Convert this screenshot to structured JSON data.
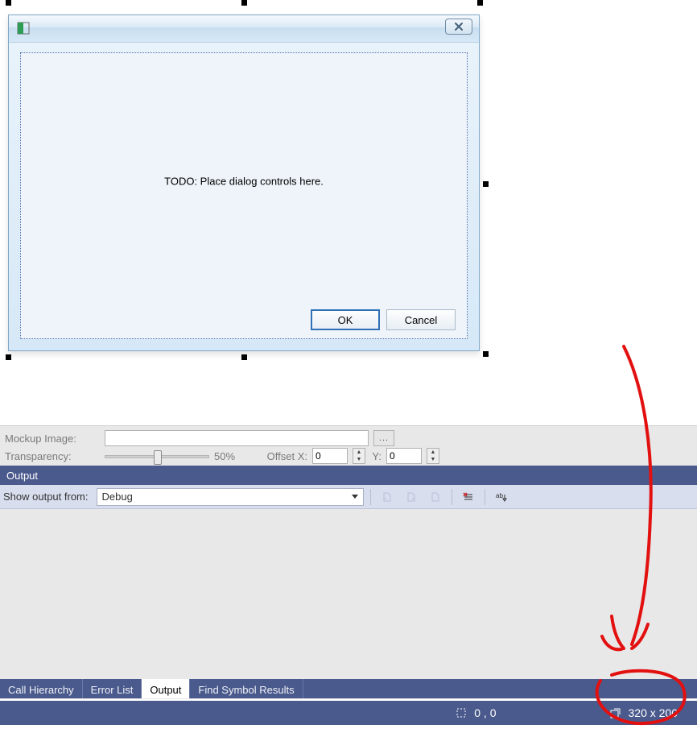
{
  "designer": {
    "dialog": {
      "placeholder": "TODO: Place dialog controls here.",
      "ok_label": "OK",
      "cancel_label": "Cancel",
      "close_icon": "close-icon",
      "sys_icon": "app-icon"
    },
    "selection_size_handles": true
  },
  "mockup_strip": {
    "label": "Mockup Image:",
    "browse_glyph": "...",
    "transparency_label": "Transparency:",
    "transparency_pct": "50%",
    "offset_x_label": "Offset X:",
    "offset_x_value": "0",
    "y_label": "Y:",
    "y_value": "0",
    "slider_pos_pct": 50
  },
  "output_panel": {
    "title": "Output",
    "show_from_label": "Show output from:",
    "selected_source": "Debug",
    "buttons": {
      "prev": "previous-message-icon",
      "next": "next-message-icon",
      "prev2": "previous-message-icon-2",
      "clear": "clear-all-icon",
      "wrap": "toggle-word-wrap-icon"
    }
  },
  "tabs": {
    "items": [
      {
        "label": "Call Hierarchy",
        "active": false
      },
      {
        "label": "Error List",
        "active": false
      },
      {
        "label": "Output",
        "active": true
      },
      {
        "label": "Find Symbol Results",
        "active": false
      }
    ]
  },
  "status": {
    "pos_icon": "crop-icon",
    "pos_text": "0 , 0",
    "size_icon": "size-icon",
    "size_text": "320 x 200"
  },
  "annotation": {
    "color": "#e31010",
    "circle_target": "status-size",
    "arrow_from": "top-right",
    "arrow_to": "status-size"
  }
}
